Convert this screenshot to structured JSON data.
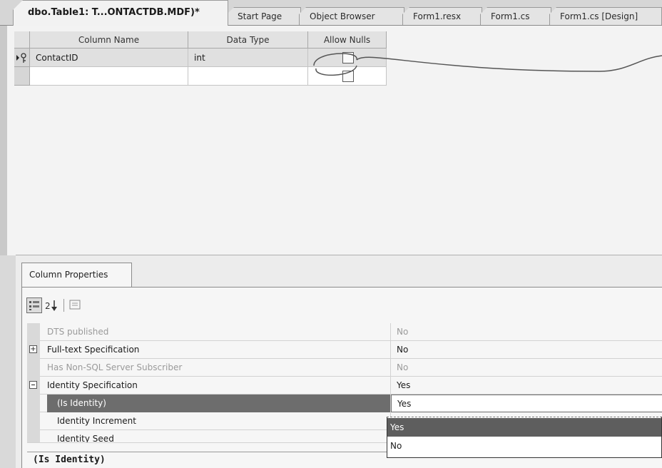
{
  "tabs": [
    {
      "label": "dbo.Table1: T...ONTACTDB.MDF)*",
      "active": true
    },
    {
      "label": "Start Page",
      "active": false
    },
    {
      "label": "Object Browser",
      "active": false
    },
    {
      "label": "Form1.resx",
      "active": false
    },
    {
      "label": "Form1.cs",
      "active": false
    },
    {
      "label": "Form1.cs [Design]",
      "active": false
    }
  ],
  "grid": {
    "headers": {
      "column_name": "Column Name",
      "data_type": "Data Type",
      "allow_nulls": "Allow Nulls"
    },
    "rows": [
      {
        "column_name": "ContactID",
        "data_type": "int",
        "allow_nulls": false,
        "primary_key": true
      },
      {
        "column_name": "",
        "data_type": "",
        "allow_nulls": false,
        "primary_key": false
      }
    ]
  },
  "properties": {
    "tab_label": "Column Properties",
    "toolbar": [
      "categorized-icon",
      "alphabetical-sort-icon",
      "property-pages-icon"
    ],
    "rows": [
      {
        "name": "DTS published",
        "value": "No",
        "dim": true,
        "expander": ""
      },
      {
        "name": "Full-text Specification",
        "value": "No",
        "dim": false,
        "expander": "+"
      },
      {
        "name": "Has Non-SQL Server Subscriber",
        "value": "No",
        "dim": true,
        "expander": ""
      },
      {
        "name": "Identity Specification",
        "value": "Yes",
        "dim": false,
        "expander": "-"
      },
      {
        "name": "(Is Identity)",
        "value": "Yes",
        "dim": false,
        "expander": ""
      },
      {
        "name": "Identity Increment",
        "value": "",
        "dim": false,
        "expander": ""
      },
      {
        "name": "Identity Seed",
        "value": "",
        "dim": false,
        "expander": ""
      }
    ],
    "dropdown_options": [
      "Yes",
      "No"
    ],
    "dropdown_selected": "Yes",
    "description_title": "(Is Identity)"
  },
  "colors": {
    "selection": "#6d6d6d",
    "grid_bg": "#f3f3f3"
  }
}
